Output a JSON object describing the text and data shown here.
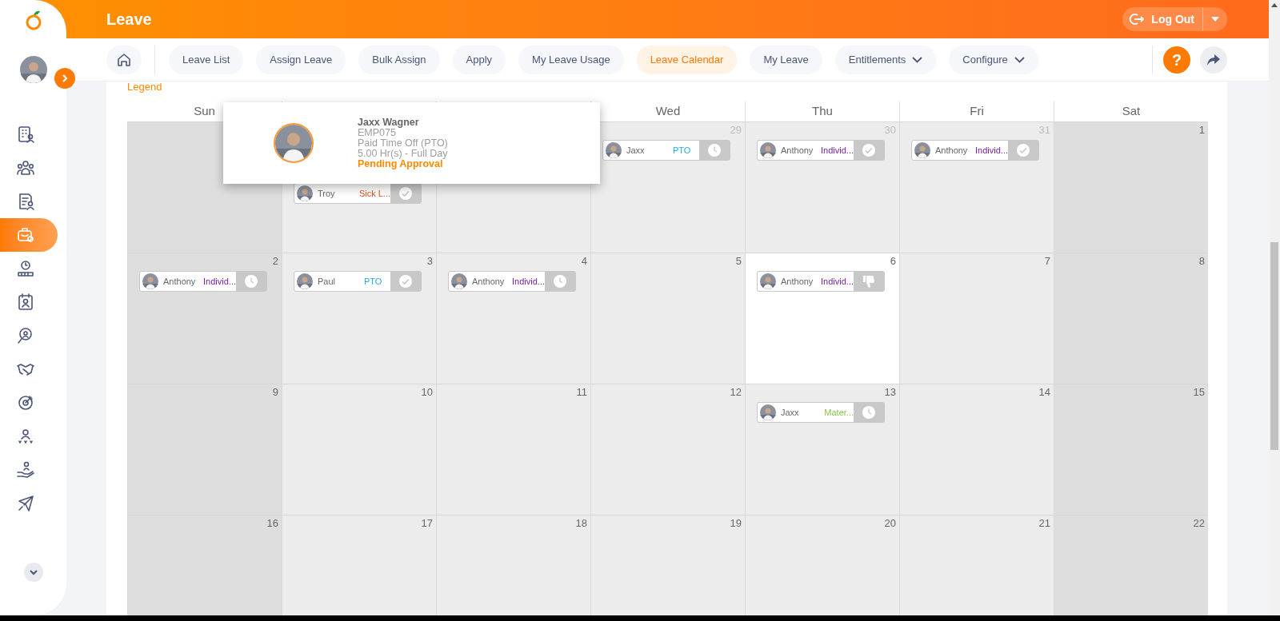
{
  "sidebar": {
    "items": [
      {
        "selected": false
      },
      {
        "selected": false
      },
      {
        "selected": false
      },
      {
        "selected": true
      },
      {
        "selected": false
      },
      {
        "selected": false
      },
      {
        "selected": false
      },
      {
        "selected": false
      },
      {
        "selected": false
      },
      {
        "selected": false
      },
      {
        "selected": false
      },
      {
        "selected": false
      }
    ]
  },
  "header": {
    "title": "Leave",
    "logout": "Log Out"
  },
  "nav": {
    "tabs": [
      {
        "label": "Leave List",
        "selected": false,
        "dropdown": false
      },
      {
        "label": "Assign Leave",
        "selected": false,
        "dropdown": false
      },
      {
        "label": "Bulk Assign",
        "selected": false,
        "dropdown": false
      },
      {
        "label": "Apply",
        "selected": false,
        "dropdown": false
      },
      {
        "label": "My Leave Usage",
        "selected": false,
        "dropdown": false
      },
      {
        "label": "Leave Calendar",
        "selected": true,
        "dropdown": false
      },
      {
        "label": "My Leave",
        "selected": false,
        "dropdown": false
      },
      {
        "label": "Entitlements",
        "selected": false,
        "dropdown": true
      },
      {
        "label": "Configure",
        "selected": false,
        "dropdown": true
      }
    ],
    "help": "?"
  },
  "legend": "Legend",
  "calendar": {
    "weekdays": [
      "Sun",
      "Wed",
      "Thu",
      "Fri",
      "Sat"
    ],
    "weeks": [
      [
        {
          "today": false
        },
        {
          "today": false,
          "events": [
            {
              "name": "Troy",
              "type": "Sick L...",
              "color": "#e64a19",
              "kind": "approved"
            }
          ]
        },
        {
          "today": false
        },
        {
          "date": "29",
          "muted": true,
          "today": false,
          "events": [
            {
              "name": "Jaxx",
              "type": "PTO",
              "color": "#29a8e0",
              "kind": "pending"
            }
          ]
        },
        {
          "date": "30",
          "muted": true,
          "today": false,
          "events": [
            {
              "name": "Anthony",
              "type": "Individ...",
              "color": "#7b1fa2",
              "kind": "approved"
            }
          ]
        },
        {
          "date": "31",
          "muted": true,
          "today": false,
          "events": [
            {
              "name": "Anthony",
              "type": "Individ...",
              "color": "#7b1fa2",
              "kind": "approved"
            }
          ]
        },
        {
          "date": "1",
          "muted": false,
          "today": false
        }
      ],
      [
        {
          "date": "2",
          "muted": false,
          "today": false,
          "events": [
            {
              "name": "Anthony",
              "type": "Individ...",
              "color": "#7b1fa2",
              "kind": "pending"
            }
          ]
        },
        {
          "date": "3",
          "muted": false,
          "today": false,
          "events": [
            {
              "name": "Paul",
              "type": "PTO",
              "color": "#29a8e0",
              "kind": "approved"
            }
          ]
        },
        {
          "date": "4",
          "muted": false,
          "today": false,
          "events": [
            {
              "name": "Anthony",
              "type": "Individ...",
              "color": "#7b1fa2",
              "kind": "pending"
            }
          ]
        },
        {
          "date": "5",
          "muted": false,
          "today": false
        },
        {
          "date": "6",
          "muted": false,
          "today": true,
          "events": [
            {
              "name": "Anthony",
              "type": "Individ...",
              "color": "#7b1fa2",
              "kind": "rejected"
            }
          ]
        },
        {
          "date": "7",
          "muted": false,
          "today": false
        },
        {
          "date": "8",
          "muted": false,
          "today": false
        }
      ],
      [
        {
          "date": "9",
          "muted": false,
          "today": false
        },
        {
          "date": "10",
          "muted": false,
          "today": false
        },
        {
          "date": "11",
          "muted": false,
          "today": false
        },
        {
          "date": "12",
          "muted": false,
          "today": false
        },
        {
          "date": "13",
          "muted": false,
          "today": false,
          "events": [
            {
              "name": "Jaxx",
              "type": "Mater...",
              "color": "#8bc34a",
              "kind": "pending"
            }
          ]
        },
        {
          "date": "14",
          "muted": false,
          "today": false
        },
        {
          "date": "15",
          "muted": false,
          "today": false
        }
      ],
      [
        {
          "date": "16",
          "muted": false,
          "today": false
        },
        {
          "date": "17",
          "muted": false,
          "today": false
        },
        {
          "date": "18",
          "muted": false,
          "today": false
        },
        {
          "date": "19",
          "muted": false,
          "today": false
        },
        {
          "date": "20",
          "muted": false,
          "today": false
        },
        {
          "date": "21",
          "muted": false,
          "today": false
        },
        {
          "date": "22",
          "muted": false,
          "today": false
        }
      ]
    ]
  },
  "popup": {
    "name": "Jaxx Wagner",
    "id": "EMP075",
    "leave_type": "Paid Time Off (PTO)",
    "duration": "5.00 Hr(s) - Full Day",
    "status": "Pending Approval"
  }
}
